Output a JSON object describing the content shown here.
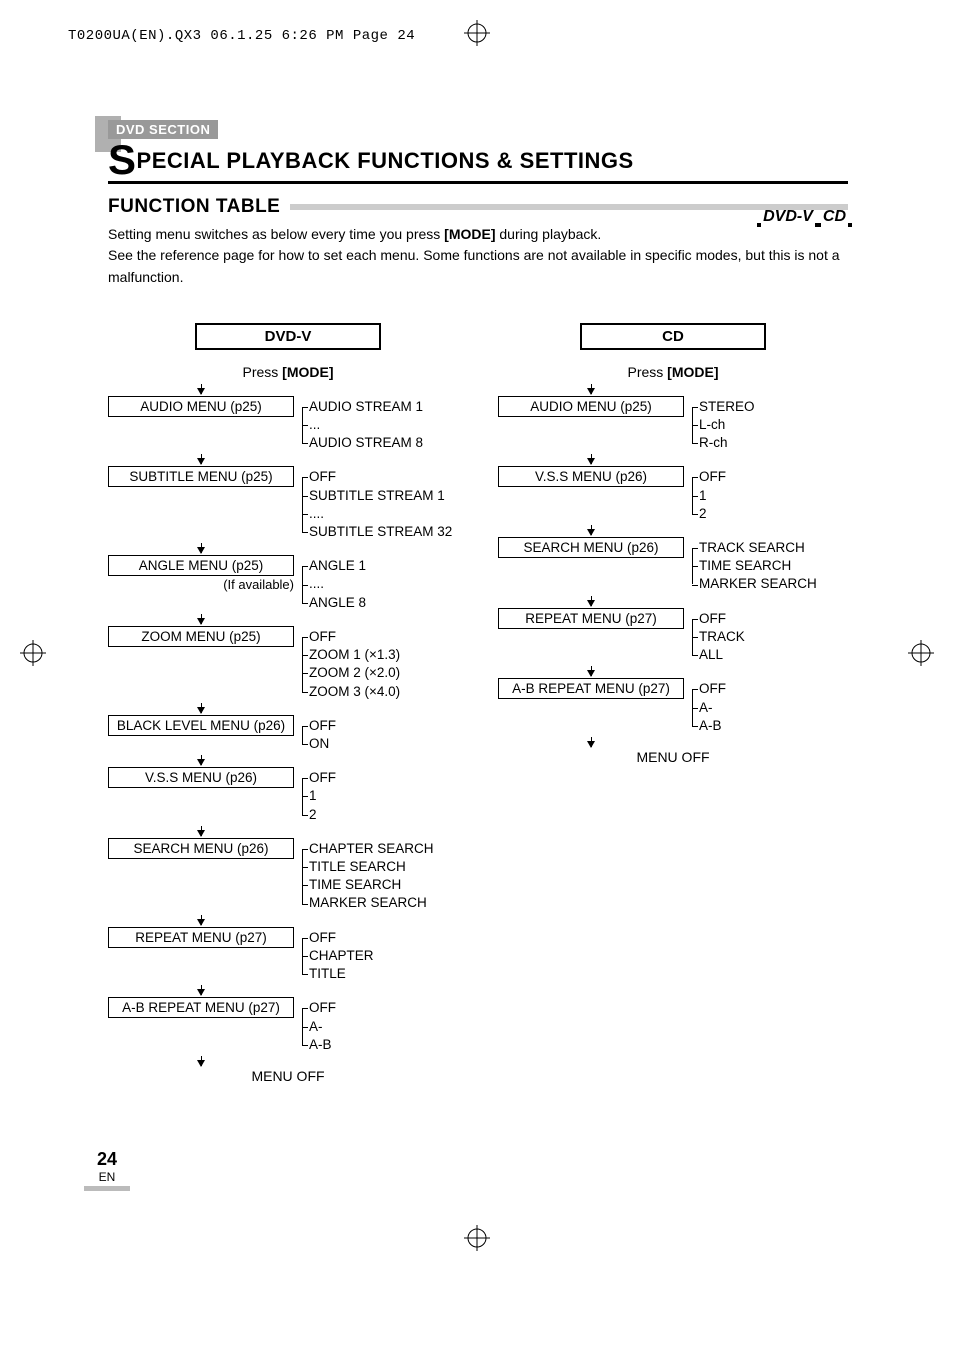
{
  "print_header": "T0200UA(EN).QX3  06.1.25  6:26 PM  Page 24",
  "section_label": "DVD SECTION",
  "title_rest": "PECIAL PLAYBACK FUNCTIONS & SETTINGS",
  "subhead": "FUNCTION TABLE",
  "body_line1_a": "Setting menu switches as below every time you press ",
  "body_line1_b": "[MODE]",
  "body_line1_c": " during playback.",
  "body_line2": "See the reference page for how to set each menu. Some functions are not available in specific modes, but this is not a malfunction.",
  "disc_icons": {
    "dvdv": "DVD-V",
    "cd": "CD"
  },
  "press_a": "Press ",
  "press_b": "[MODE]",
  "menu_off": "MENU OFF",
  "dvd": {
    "header": "DVD-V",
    "nodes": [
      {
        "label": "AUDIO MENU (p25)",
        "opts": [
          "AUDIO STREAM 1",
          "...",
          "AUDIO STREAM 8"
        ]
      },
      {
        "label": "SUBTITLE MENU (p25)",
        "opts": [
          "OFF",
          "SUBTITLE STREAM 1",
          "....",
          "SUBTITLE STREAM 32"
        ]
      },
      {
        "label": "ANGLE MENU (p25)",
        "note": "(If available)",
        "opts": [
          "ANGLE 1",
          "....",
          "ANGLE 8"
        ]
      },
      {
        "label": "ZOOM MENU (p25)",
        "opts": [
          "OFF",
          "ZOOM 1 (×1.3)",
          "ZOOM 2 (×2.0)",
          "ZOOM 3 (×4.0)"
        ]
      },
      {
        "label": "BLACK LEVEL MENU (p26)",
        "opts": [
          "OFF",
          "ON"
        ]
      },
      {
        "label": "V.S.S MENU (p26)",
        "opts": [
          "OFF",
          "1",
          "2"
        ]
      },
      {
        "label": "SEARCH MENU (p26)",
        "opts": [
          "CHAPTER SEARCH",
          "TITLE SEARCH",
          "TIME SEARCH",
          "MARKER SEARCH"
        ]
      },
      {
        "label": "REPEAT MENU (p27)",
        "opts": [
          "OFF",
          "CHAPTER",
          "TITLE"
        ]
      },
      {
        "label": "A-B REPEAT MENU (p27)",
        "opts": [
          "OFF",
          "A-",
          "A-B"
        ]
      }
    ]
  },
  "cd": {
    "header": "CD",
    "nodes": [
      {
        "label": "AUDIO MENU (p25)",
        "opts": [
          "STEREO",
          "L-ch",
          "R-ch"
        ]
      },
      {
        "label": "V.S.S MENU (p26)",
        "opts": [
          "OFF",
          "1",
          "2"
        ]
      },
      {
        "label": "SEARCH MENU (p26)",
        "opts": [
          "TRACK SEARCH",
          "TIME SEARCH",
          "MARKER SEARCH"
        ]
      },
      {
        "label": "REPEAT MENU (p27)",
        "opts": [
          "OFF",
          "TRACK",
          "ALL"
        ]
      },
      {
        "label": "A-B REPEAT MENU (p27)",
        "opts": [
          "OFF",
          "A-",
          "A-B"
        ]
      }
    ]
  },
  "page_num": "24",
  "page_lang": "EN"
}
